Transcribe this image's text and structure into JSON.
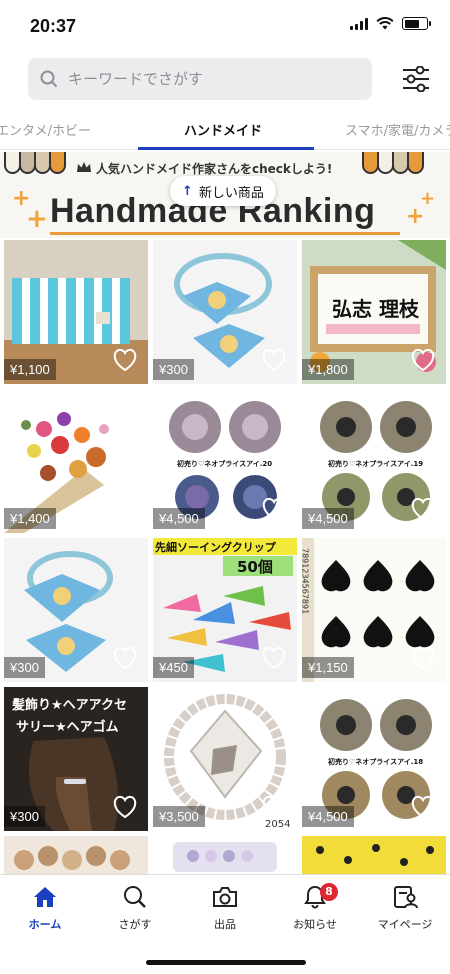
{
  "status": {
    "time": "20:37"
  },
  "search": {
    "placeholder": "キーワードでさがす"
  },
  "tabs": [
    {
      "label": "エンタメ/ホビー"
    },
    {
      "label": "ハンドメイド",
      "active": true
    },
    {
      "label": "スマホ/家電/カメラ"
    }
  ],
  "banner": {
    "subtitle": "人気ハンドメイド作家さんをcheckしよう!",
    "title": "Handmade Ranking",
    "new_items_label": "新しい商品"
  },
  "products": [
    {
      "price": "¥1,100",
      "name": "striped-pouch"
    },
    {
      "price": "¥300",
      "name": "princess-hair-bows"
    },
    {
      "price": "¥1,800",
      "name": "name-calligraphy-frame"
    },
    {
      "price": "¥1,400",
      "name": "dried-flower-bouquet"
    },
    {
      "price": "¥4,500",
      "name": "resin-eyes-20",
      "caption": "初売り♡ネオプライスアイ.20"
    },
    {
      "price": "¥4,500",
      "name": "resin-eyes-19",
      "caption": "初売り♡ネオプライスアイ.19"
    },
    {
      "price": "¥300",
      "name": "princess-hair-bows-2"
    },
    {
      "price": "¥450",
      "name": "sewing-clips",
      "caption": "先細ソーイングクリップ",
      "caption2": "50個"
    },
    {
      "price": "¥1,150",
      "name": "spade-stickers",
      "caption": "7891234567891"
    },
    {
      "price": "¥300",
      "name": "hair-tie",
      "caption": "髪飾り★ヘアアクセ",
      "caption2": "サリー★ヘアゴム"
    },
    {
      "price": "¥3,500",
      "name": "crystal-bracelet",
      "caption": "2054"
    },
    {
      "price": "¥4,500",
      "name": "resin-eyes-18",
      "caption": "初売り♡ネオプライスアイ.18"
    }
  ],
  "nav": [
    {
      "label": "ホーム",
      "icon": "home-icon",
      "active": true
    },
    {
      "label": "さがす",
      "icon": "search-icon"
    },
    {
      "label": "出品",
      "icon": "camera-icon"
    },
    {
      "label": "お知らせ",
      "icon": "bell-icon",
      "badge": "8"
    },
    {
      "label": "マイページ",
      "icon": "profile-icon"
    }
  ],
  "colors": {
    "accent": "#1c3fbf",
    "badge": "#e0262e",
    "banner_accent": "#e79a3a"
  }
}
